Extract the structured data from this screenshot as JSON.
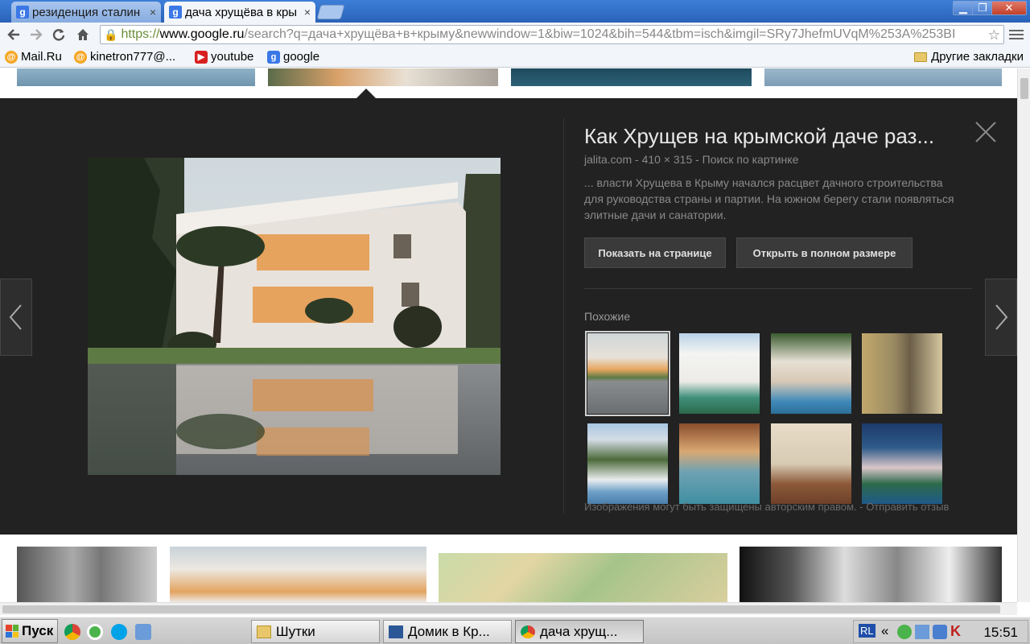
{
  "browser": {
    "tabs": [
      {
        "title": "резиденция сталин",
        "favicon": "google-icon",
        "active": false
      },
      {
        "title": "дача хрущёва в кры",
        "favicon": "google-icon",
        "active": true
      }
    ],
    "url": {
      "scheme": "https://",
      "host": "www.google.ru",
      "path": "/search?q=дача+хрущёва+в+крыму&newwindow=1&biw=1024&bih=544&tbm=isch&imgil=SRy7JhefmUVqM%253A%253BI"
    },
    "bookmarks": [
      {
        "label": "Mail.Ru",
        "icon": "mailru-icon"
      },
      {
        "label": "kinetron777@...",
        "icon": "mailru-icon"
      },
      {
        "label": "youtube",
        "icon": "youtube-icon"
      },
      {
        "label": "google",
        "icon": "google-icon"
      }
    ],
    "other_bookmarks": "Другие закладки"
  },
  "preview": {
    "title": "Как Хрущев на крымской даче раз...",
    "meta": "jalita.com - 410 × 315 - Поиск по картинке",
    "description": "... власти Хрущева в Крыму начался расцвет дачного строительства для руководства страны и партии. На южном берегу стали появляться элитные дачи и санатории.",
    "btn_show": "Показать на странице",
    "btn_open": "Открыть в полном размере",
    "similar_label": "Похожие",
    "footer_note": "Изображения могут быть защищены авторским правом.  -  Отправить отзыв"
  },
  "taskbar": {
    "start": "Пуск",
    "tasks": [
      {
        "label": "Шутки",
        "icon": "folder-icon"
      },
      {
        "label": "Домик в Кр...",
        "icon": "word-icon"
      },
      {
        "label": "дача хрущ...",
        "icon": "chrome-icon"
      }
    ],
    "lang": "RL",
    "clock": "15:51"
  }
}
